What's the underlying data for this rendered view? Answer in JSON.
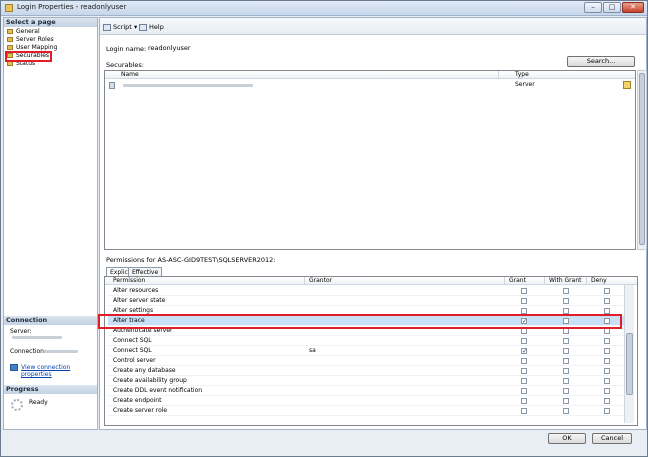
{
  "window": {
    "title": "Login Properties - readonlyuser",
    "min_glyph": "–",
    "max_glyph": "□",
    "close_glyph": "✕"
  },
  "left": {
    "select_page_header": "Select a page",
    "pages": [
      "General",
      "Server Roles",
      "User Mapping",
      "Securables",
      "Status"
    ],
    "selected_page": "Securables",
    "connection_header": "Connection",
    "server_label": "Server:",
    "connection_label": "Connection:",
    "view_link": "View connection properties",
    "progress_header": "Progress",
    "progress_status": "Ready"
  },
  "toolbar": {
    "script": "Script",
    "script_arrow": "▾",
    "help": "Help"
  },
  "login": {
    "label": "Login name:",
    "value": "readonlyuser"
  },
  "securables": {
    "label": "Securables:",
    "search_button": "Search...",
    "columns": [
      "Name",
      "Type"
    ],
    "rows": [
      {
        "type": "Server"
      }
    ]
  },
  "permissions": {
    "label": "Permissions for AS-ASC-GID9TEST\\SQLSERVER2012:",
    "tabs": [
      "Explicit",
      "Effective"
    ],
    "columns": [
      "Permission",
      "Grantor",
      "Grant",
      "With Grant",
      "Deny"
    ],
    "rows": [
      {
        "permission": "Alter resources",
        "grantor": "",
        "grant": false,
        "with_grant": false,
        "deny": false
      },
      {
        "permission": "Alter server state",
        "grantor": "",
        "grant": false,
        "with_grant": false,
        "deny": false
      },
      {
        "permission": "Alter settings",
        "grantor": "",
        "grant": false,
        "with_grant": false,
        "deny": false
      },
      {
        "permission": "Alter trace",
        "grantor": "",
        "grant": true,
        "with_grant": false,
        "deny": false,
        "selected": true
      },
      {
        "permission": "Authenticate server",
        "grantor": "",
        "grant": false,
        "with_grant": false,
        "deny": false
      },
      {
        "permission": "Connect SQL",
        "grantor": "",
        "grant": false,
        "with_grant": false,
        "deny": false
      },
      {
        "permission": "Connect SQL",
        "grantor": "sa",
        "grant": true,
        "with_grant": false,
        "deny": false
      },
      {
        "permission": "Control server",
        "grantor": "",
        "grant": false,
        "with_grant": false,
        "deny": false
      },
      {
        "permission": "Create any database",
        "grantor": "",
        "grant": false,
        "with_grant": false,
        "deny": false
      },
      {
        "permission": "Create availability group",
        "grantor": "",
        "grant": false,
        "with_grant": false,
        "deny": false
      },
      {
        "permission": "Create DDL event notification",
        "grantor": "",
        "grant": false,
        "with_grant": false,
        "deny": false
      },
      {
        "permission": "Create endpoint",
        "grantor": "",
        "grant": false,
        "with_grant": false,
        "deny": false
      },
      {
        "permission": "Create server role",
        "grantor": "",
        "grant": false,
        "with_grant": false,
        "deny": false
      }
    ]
  },
  "buttons": {
    "ok": "OK",
    "cancel": "Cancel"
  },
  "colors": {
    "highlight": "#e21d2a",
    "selection": "#c9e0f7"
  }
}
